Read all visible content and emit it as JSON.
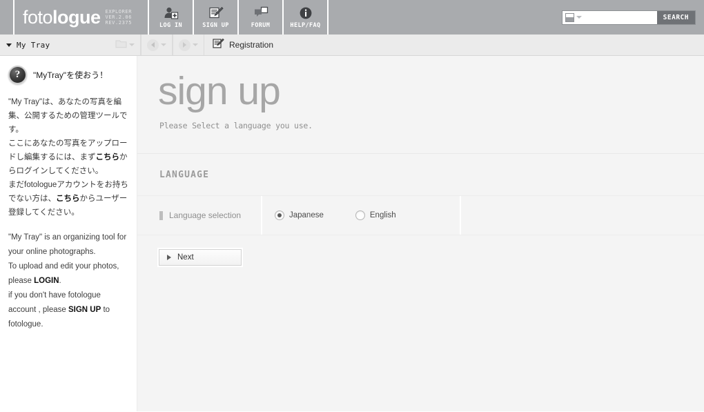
{
  "header": {
    "logo": {
      "part1": "foto",
      "part2": "logue"
    },
    "version_lines": [
      "EXPLORER",
      "VER.2.06",
      "REV.2375"
    ],
    "nav": [
      {
        "label": "LOG IN",
        "icon": "user-add-icon"
      },
      {
        "label": "SIGN UP",
        "icon": "pencil-form-icon"
      },
      {
        "label": "FORUM",
        "icon": "speech-bubbles-icon"
      },
      {
        "label": "HELP/FAQ",
        "icon": "info-circle-icon"
      }
    ],
    "search": {
      "value": "",
      "placeholder": "",
      "button_label": "SEARCH",
      "type_icon": "image-thumb-icon"
    }
  },
  "toolbar": {
    "tray_label": "My Tray",
    "folder_icon": "folder-icon",
    "back_icon": "back-arrow-icon",
    "forward_icon": "forward-arrow-icon",
    "tab_label": "Registration",
    "tab_icon": "registration-pencil-icon"
  },
  "sidebar": {
    "tip_icon": "question-mark-icon",
    "tip_title": "\"MyTray\"を使おう！",
    "paragraph_ja_1": "\"My Tray\"は、あなたの写真を編集、公開するための管理ツールです。",
    "paragraph_ja_2_pre": "ここにあなたの写真をアップロードし編集するには、まず",
    "paragraph_ja_2_link": "こちら",
    "paragraph_ja_2_post": "からログインしてください。",
    "paragraph_ja_3_pre": "まだfotologueアカウントをお持ちでない方は、",
    "paragraph_ja_3_link": "こちら",
    "paragraph_ja_3_post": "からユーザー登録してください。",
    "paragraph_en_1": "\"My Tray\" is an organizing tool for your online photographs.",
    "paragraph_en_2_pre": "To upload and edit your photos, please ",
    "paragraph_en_2_link": "LOGIN",
    "paragraph_en_2_post": ".",
    "paragraph_en_3_pre": "if you don't have fotologue account , please ",
    "paragraph_en_3_link": "SIGN UP",
    "paragraph_en_3_post": " to fotologue."
  },
  "main": {
    "hero_title": "sign up",
    "hero_subtitle": "Please Select a language you use.",
    "section_title": "LANGUAGE",
    "form": {
      "label": "Language selection",
      "options": [
        {
          "label": "Japanese",
          "selected": true
        },
        {
          "label": "English",
          "selected": false
        }
      ]
    },
    "next_button": "Next"
  },
  "colors": {
    "header_bg": "#a9abae",
    "toolbar_bg": "#ebebeb",
    "content_bg": "#f4f4f4",
    "search_button_bg": "#6f7276",
    "hero_title": "#a6a6a6"
  }
}
